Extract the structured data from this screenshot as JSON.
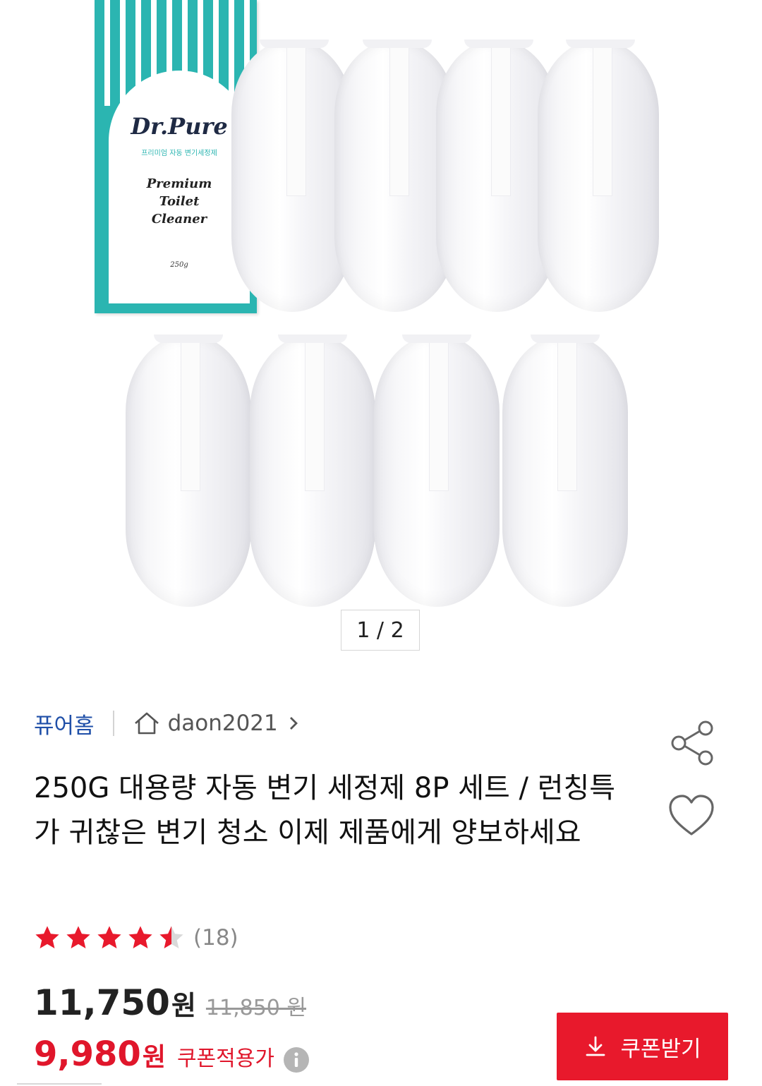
{
  "product_image": {
    "box_brand": "Dr.Pure",
    "box_subtitle": "프리미엄 자동 변기세정제",
    "box_name": "Premium\nToilet\nCleaner",
    "box_weight": "250g",
    "counter": "1 / 2"
  },
  "store": {
    "name": "퓨어홈",
    "seller": "daon2021"
  },
  "product": {
    "title": "250G 대용량 자동 변기 세정제 8P 세트 / 런칭특가 귀찮은 변기 청소 이제 제품에게 양보하세요",
    "rating": 4.5,
    "review_count": "(18)",
    "price": "11,750",
    "price_unit": "원",
    "original_price": "11,850 원",
    "coupon_price": "9,980",
    "coupon_unit": "원",
    "coupon_label": "쿠폰적용가",
    "coupon_button": "쿠폰받기"
  },
  "icons": {
    "home": "home-icon",
    "chevron": "chevron-right-icon",
    "share": "share-icon",
    "heart": "heart-icon",
    "star": "star-icon",
    "info": "info-icon",
    "download": "download-icon"
  },
  "colors": {
    "accent_red": "#e8192c",
    "store_blue": "#1f4fa8",
    "box_teal": "#2bb5b1"
  }
}
